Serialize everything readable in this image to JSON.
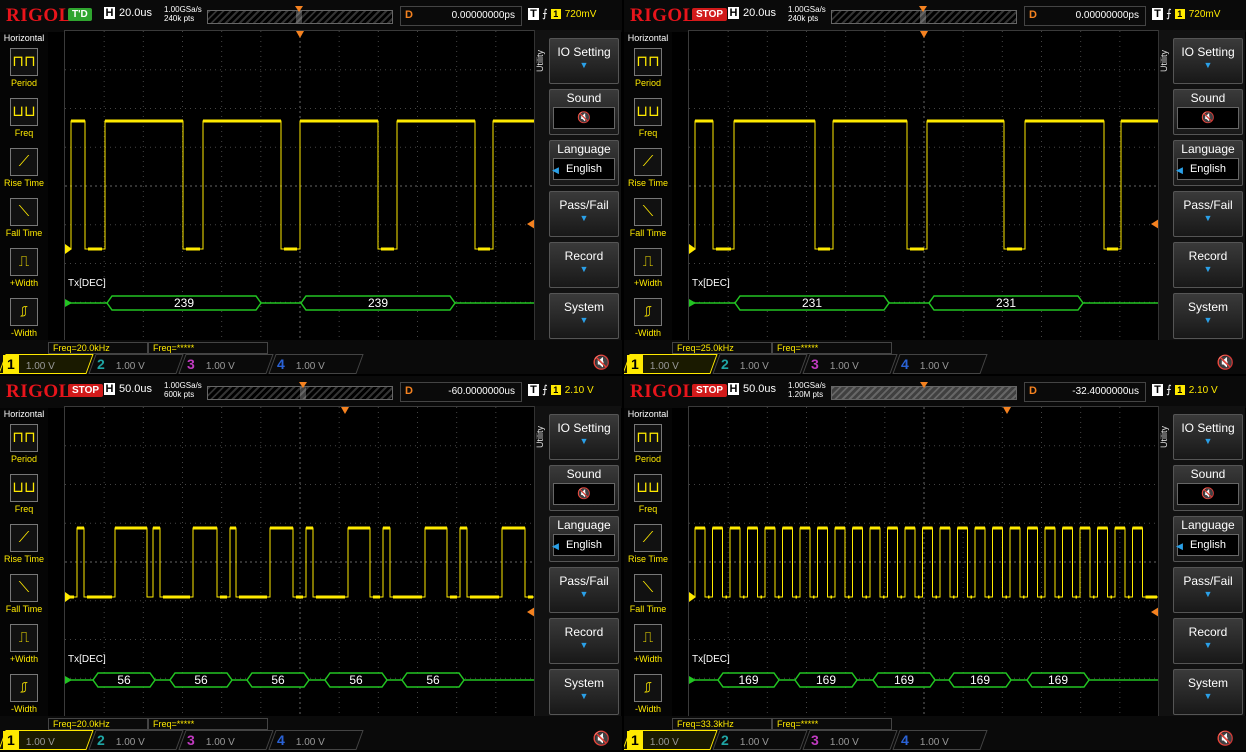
{
  "scopes": [
    {
      "id": "tl",
      "logo": "RIGOL",
      "status": "T'D",
      "status_kind": "run",
      "h_label": "H",
      "timebase": "20.0us",
      "sample_rate": "1.00GSa/s",
      "mem_depth": "240k pts",
      "d_label": "D",
      "delay": "0.00000000ps",
      "t_label": "T",
      "trigger_source": "1",
      "trigger_level": "720mV",
      "menu_title": "Horizontal",
      "menu_items": [
        "Period",
        "Freq",
        "Rise Time",
        "Fall Time",
        "+Width",
        "-Width"
      ],
      "utility": "Utility",
      "buttons": [
        "IO Setting",
        "Sound",
        "Language",
        "Pass/Fail",
        "Record",
        "System"
      ],
      "language_value": "English",
      "tx_label": "Tx[DEC]",
      "decode_values": [
        "239",
        "239"
      ],
      "freq_meas": "Freq=20.0kHz",
      "freq_meas2": "Freq=*****",
      "channels": [
        "1",
        "2",
        "3",
        "4"
      ],
      "channel_scale": "1.00 V"
    },
    {
      "id": "tr",
      "logo": "RIGOL",
      "status": "STOP",
      "status_kind": "stop",
      "h_label": "H",
      "timebase": "20.0us",
      "sample_rate": "1.00GSa/s",
      "mem_depth": "240k pts",
      "d_label": "D",
      "delay": "0.00000000ps",
      "t_label": "T",
      "trigger_source": "1",
      "trigger_level": "720mV",
      "menu_title": "Horizontal",
      "menu_items": [
        "Period",
        "Freq",
        "Rise Time",
        "Fall Time",
        "+Width",
        "-Width"
      ],
      "utility": "Utility",
      "buttons": [
        "IO Setting",
        "Sound",
        "Language",
        "Pass/Fail",
        "Record",
        "System"
      ],
      "language_value": "English",
      "tx_label": "Tx[DEC]",
      "decode_values": [
        "231",
        "231"
      ],
      "freq_meas": "Freq=25.0kHz",
      "freq_meas2": "Freq=*****",
      "channels": [
        "1",
        "2",
        "3",
        "4"
      ],
      "channel_scale": "1.00 V"
    },
    {
      "id": "bl",
      "logo": "RIGOL",
      "status": "STOP",
      "status_kind": "stop",
      "h_label": "H",
      "timebase": "50.0us",
      "sample_rate": "1.00GSa/s",
      "mem_depth": "600k pts",
      "d_label": "D",
      "delay": "-60.0000000us",
      "t_label": "T",
      "trigger_source": "1",
      "trigger_level": "2.10 V",
      "menu_title": "Horizontal",
      "menu_items": [
        "Period",
        "Freq",
        "Rise Time",
        "Fall Time",
        "+Width",
        "-Width"
      ],
      "utility": "Utility",
      "buttons": [
        "IO Setting",
        "Sound",
        "Language",
        "Pass/Fail",
        "Record",
        "System"
      ],
      "language_value": "English",
      "tx_label": "Tx[DEC]",
      "decode_values": [
        "56",
        "56",
        "56",
        "56",
        "56"
      ],
      "freq_meas": "Freq=20.0kHz",
      "freq_meas2": "Freq=*****",
      "channels": [
        "1",
        "2",
        "3",
        "4"
      ],
      "channel_scale": "1.00 V"
    },
    {
      "id": "br",
      "logo": "RIGOL",
      "status": "STOP",
      "status_kind": "stop",
      "h_label": "H",
      "timebase": "50.0us",
      "sample_rate": "1.00GSa/s",
      "mem_depth": "1.20M pts",
      "d_label": "D",
      "delay": "-32.4000000us",
      "t_label": "T",
      "trigger_source": "1",
      "trigger_level": "2.10 V",
      "menu_title": "Horizontal",
      "menu_items": [
        "Period",
        "Freq",
        "Rise Time",
        "Fall Time",
        "+Width",
        "-Width"
      ],
      "utility": "Utility",
      "buttons": [
        "IO Setting",
        "Sound",
        "Language",
        "Pass/Fail",
        "Record",
        "System"
      ],
      "language_value": "English",
      "tx_label": "Tx[DEC]",
      "decode_values": [
        "169",
        "169",
        "169",
        "169",
        "169"
      ],
      "freq_meas": "Freq=33.3kHz",
      "freq_meas2": "Freq=*****",
      "channels": [
        "1",
        "2",
        "3",
        "4"
      ],
      "channel_scale": "1.00 V"
    }
  ],
  "colors": {
    "ch1": "#ffea00",
    "ch2": "#1fa5a5",
    "ch3": "#c03ac0",
    "ch4": "#2a62d6",
    "decode": "#22c422",
    "trigger": "#f58220",
    "logo": "#e8141b"
  },
  "icons": {
    "period": "period-icon",
    "freq": "freq-icon",
    "rise": "rise-time-icon",
    "fall": "fall-time-icon",
    "pwidth": "positive-width-icon",
    "nwidth": "negative-width-icon",
    "sound": "speaker-muted-icon"
  }
}
